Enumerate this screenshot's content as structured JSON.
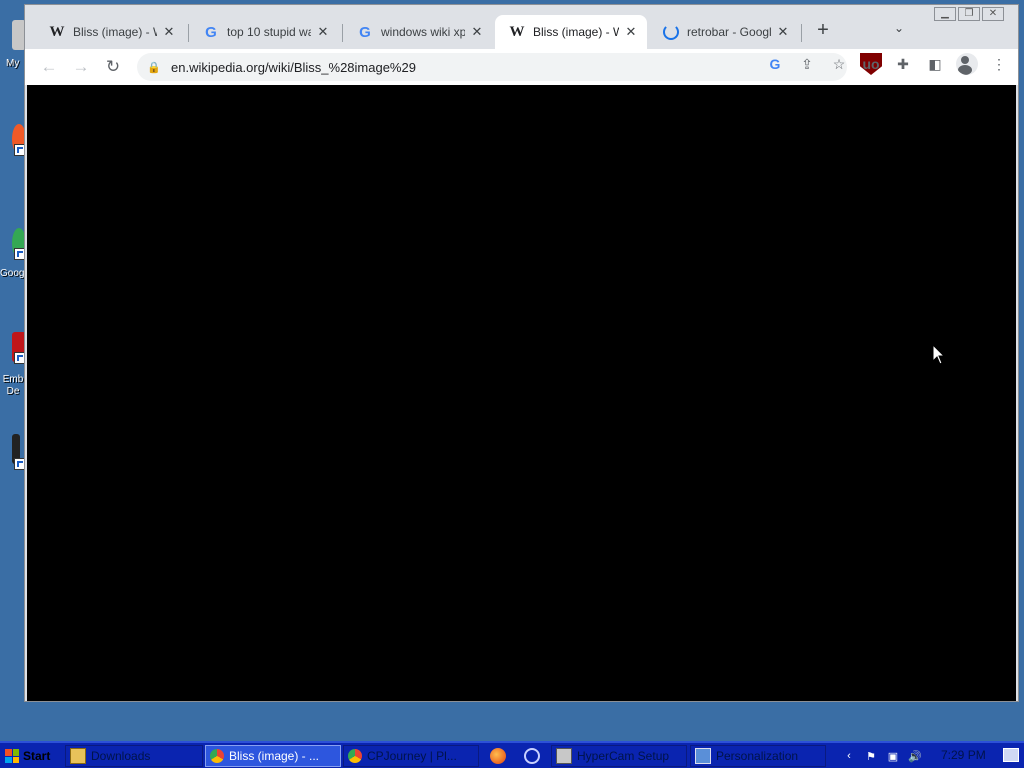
{
  "desktop": {
    "icons": [
      {
        "label": "My",
        "icon": "my-computer-icon"
      },
      {
        "label": "",
        "icon": "firefox-shortcut-icon"
      },
      {
        "label": "Goog",
        "icon": "chrome-shortcut-icon"
      },
      {
        "label": "Emb De",
        "icon": "embedded-shortcut-icon"
      },
      {
        "label": "",
        "icon": "app-shortcut-icon"
      }
    ]
  },
  "browser": {
    "tabs": [
      {
        "title": "Bliss (image) - W",
        "favicon": "wikipedia-icon",
        "active": false
      },
      {
        "title": "top 10 stupid wa",
        "favicon": "google-icon",
        "active": false
      },
      {
        "title": "windows wiki xp",
        "favicon": "google-icon",
        "active": false
      },
      {
        "title": "Bliss (image) - W",
        "favicon": "wikipedia-icon",
        "active": true
      },
      {
        "title": "retrobar - Googl",
        "favicon": "loading-spinner-icon",
        "active": false
      }
    ],
    "address": {
      "url": "en.wikipedia.org/wiki/Bliss_%28image%29"
    },
    "page_content_color": "#000000"
  },
  "taskbar": {
    "start_label": "Start",
    "tasks": [
      {
        "label": "Downloads",
        "icon": "folder-icon",
        "active": false
      },
      {
        "label": "Bliss (image) - ...",
        "icon": "chrome-icon",
        "active": true
      },
      {
        "label": "CPJourney | Pl...",
        "icon": "chrome-icon",
        "active": false
      },
      {
        "label": "HyperCam Setup",
        "icon": "setup-icon",
        "active": false
      },
      {
        "label": "Personalization",
        "icon": "personalization-icon",
        "active": false
      }
    ],
    "quick_launch": [
      "firefox-icon",
      "paint-icon"
    ],
    "tray_icons": [
      "chevron-icon",
      "network-icon",
      "monitor-icon",
      "volume-icon"
    ],
    "clock": "7:29 PM"
  },
  "colors": {
    "desktop": "#3a6ea5",
    "taskbar": "#0a24b0",
    "chrome_frame": "#dee1e6"
  }
}
